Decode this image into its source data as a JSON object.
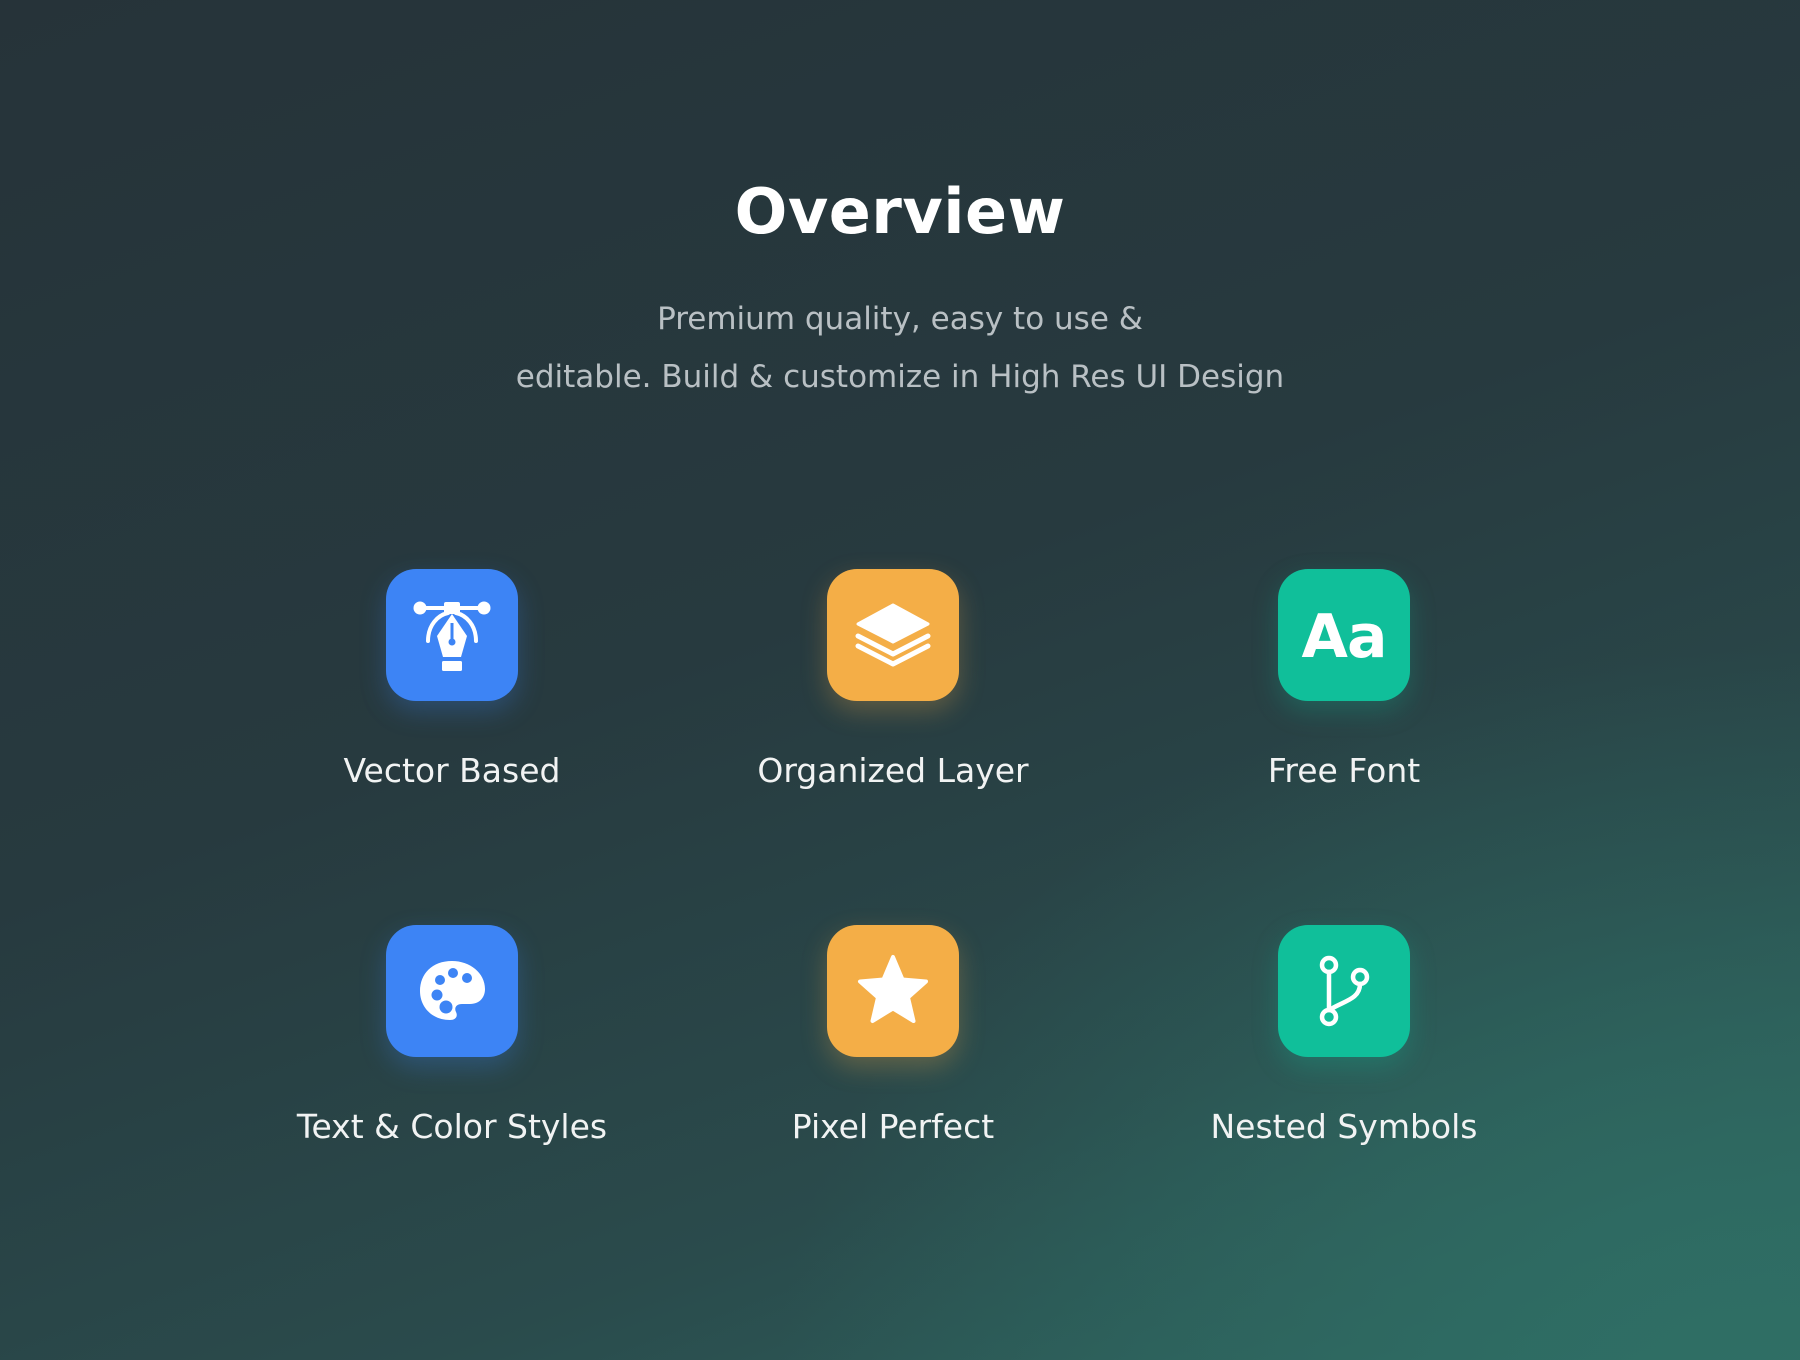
{
  "header": {
    "title": "Overview",
    "subtitle_line1": "Premium quality, easy to use &",
    "subtitle_line2": "editable. Build & customize in High Res UI Design"
  },
  "features": [
    {
      "label": "Vector Based",
      "icon": "pen-tool-icon",
      "color": "#3d84f5"
    },
    {
      "label": "Organized Layer",
      "icon": "layers-icon",
      "color": "#f4ae47"
    },
    {
      "label": "Free Font",
      "icon": "font-icon",
      "icon_text": "Aa",
      "color": "#10bf9a"
    },
    {
      "label": "Text & Color Styles",
      "icon": "palette-icon",
      "color": "#3d84f5"
    },
    {
      "label": "Pixel Perfect",
      "icon": "star-icon",
      "color": "#f4ae47"
    },
    {
      "label": "Nested Symbols",
      "icon": "git-branch-icon",
      "color": "#10bf9a"
    }
  ]
}
